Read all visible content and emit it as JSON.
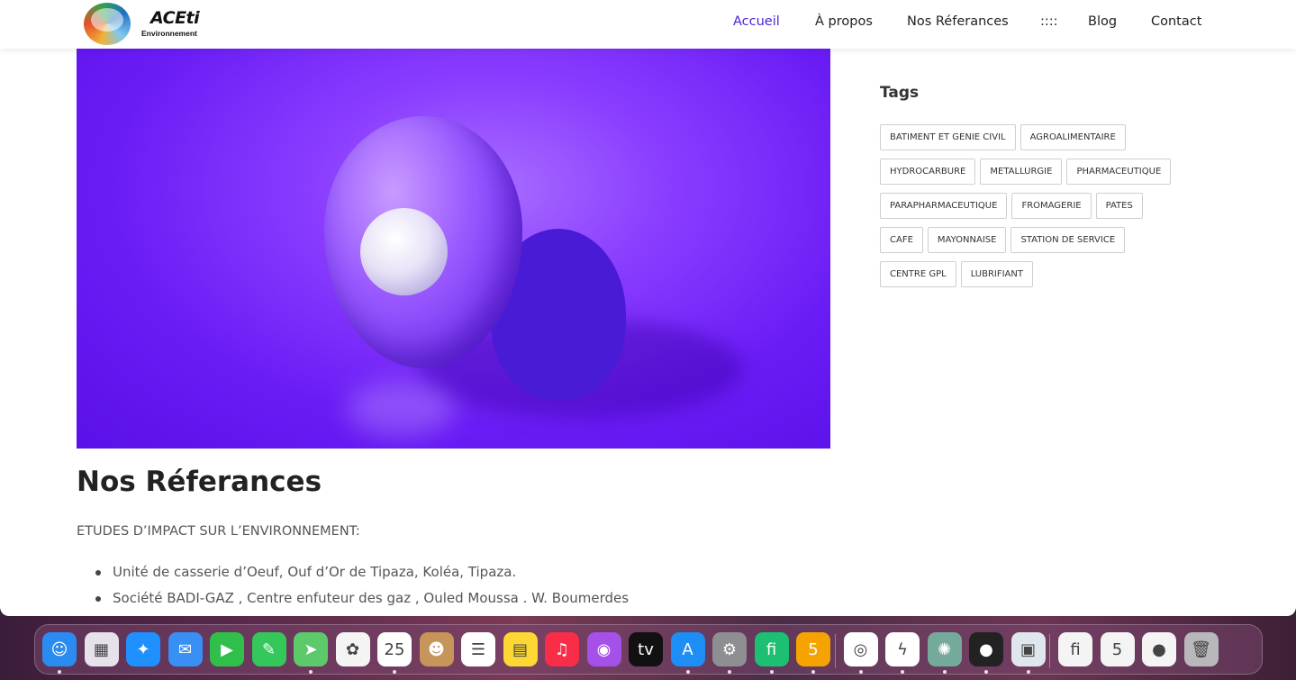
{
  "header": {
    "logo_title": "ACEti",
    "logo_subtitle": "Environnement",
    "nav": [
      {
        "label": "Accueil",
        "active": true
      },
      {
        "label": "À propos"
      },
      {
        "label": "Nos Réferances"
      },
      {
        "label": "::::"
      },
      {
        "label": "Blog"
      },
      {
        "label": "Contact"
      }
    ]
  },
  "main": {
    "title": "Nos Réferances",
    "section_heading": "ETUDES D’IMPACT SUR L’ENVIRONNEMENT:",
    "references": [
      "Unité de casserie d’Oeuf, Ouf d’Or de Tipaza, Koléa, Tipaza.",
      "Société BADI-GAZ , Centre enfuteur des gaz , Ouled Moussa . W. Boumerdes"
    ]
  },
  "sidebar": {
    "tags_title": "Tags",
    "tags": [
      "BATIMENT ET GENIE CIVIL",
      "AGROALIMENTAIRE",
      "HYDROCARBURE",
      "METALLURGIE",
      "PHARMACEUTIQUE",
      "PARAPHARMACEUTIQUE",
      "FROMAGERIE",
      "PATES",
      "CAFE",
      "MAYONNAISE",
      "STATION DE SERVICE",
      "CENTRE GPL",
      "LUBRIFIANT"
    ]
  },
  "dock": {
    "apps": [
      {
        "name": "finder-icon",
        "color": "#2a8cf0",
        "glyph": "☺"
      },
      {
        "name": "launchpad-icon",
        "color": "#e6e1ea",
        "glyph": "▦"
      },
      {
        "name": "safari-icon",
        "color": "#1e90ff",
        "glyph": "✦"
      },
      {
        "name": "mail-icon",
        "color": "#3a8ff5",
        "glyph": "✉"
      },
      {
        "name": "facetime-icon",
        "color": "#2fbf4a",
        "glyph": "▶"
      },
      {
        "name": "messages-icon",
        "color": "#34c759",
        "glyph": "✎"
      },
      {
        "name": "maps-icon",
        "color": "#5cc96b",
        "glyph": "➤"
      },
      {
        "name": "photos-icon",
        "color": "#f4f4f4",
        "glyph": "✿"
      },
      {
        "name": "calendar-icon",
        "color": "#ffffff",
        "glyph": "25"
      },
      {
        "name": "contacts-icon",
        "color": "#c7945a",
        "glyph": "☻"
      },
      {
        "name": "reminders-icon",
        "color": "#ffffff",
        "glyph": "☰"
      },
      {
        "name": "notes-icon",
        "color": "#fdd835",
        "glyph": "▤"
      },
      {
        "name": "music-icon",
        "color": "#fa2d48",
        "glyph": "♫"
      },
      {
        "name": "podcasts-icon",
        "color": "#a550e8",
        "glyph": "◉"
      },
      {
        "name": "tv-icon",
        "color": "#111111",
        "glyph": "tv"
      },
      {
        "name": "app-store-icon",
        "color": "#1c8ef5",
        "glyph": "A"
      },
      {
        "name": "system-settings-icon",
        "color": "#8e8e93",
        "glyph": "⚙"
      },
      {
        "name": "fiverr-icon",
        "color": "#1dbf73",
        "glyph": "fi"
      },
      {
        "name": "khamsat-icon",
        "color": "#f5a300",
        "glyph": "5"
      },
      {
        "name": "chrome-icon",
        "color": "#ffffff",
        "glyph": "◎"
      },
      {
        "name": "messenger-icon",
        "color": "#ffffff",
        "glyph": "ϟ"
      },
      {
        "name": "chatgpt-icon",
        "color": "#74aa9c",
        "glyph": "✺"
      },
      {
        "name": "screen-recorder-icon",
        "color": "#222222",
        "glyph": "●"
      },
      {
        "name": "preview-icon",
        "color": "#dfe6ee",
        "glyph": "▣"
      },
      {
        "name": "window-thumbnail-1-icon",
        "color": "#f4f4f4",
        "glyph": "fi"
      },
      {
        "name": "window-thumbnail-2-icon",
        "color": "#f4f4f4",
        "glyph": "5"
      },
      {
        "name": "window-thumbnail-3-icon",
        "color": "#f4f4f4",
        "glyph": "●"
      },
      {
        "name": "trash-icon",
        "color": "#b8b8bc",
        "glyph": "🗑"
      }
    ]
  },
  "colors": {
    "accent": "#4b1fd8",
    "text": "#222222",
    "muted": "#555555"
  }
}
